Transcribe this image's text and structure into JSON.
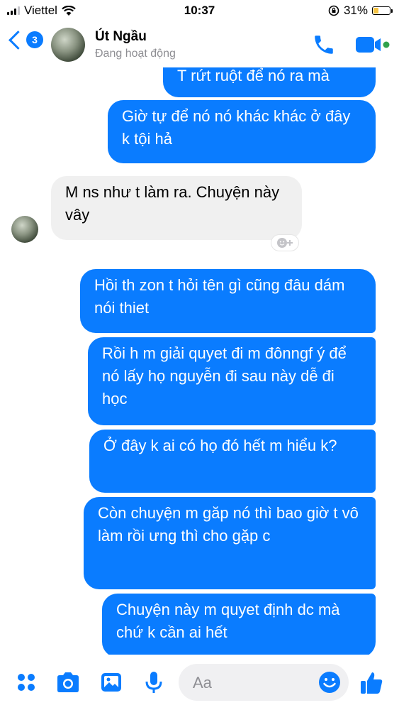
{
  "status_bar": {
    "carrier": "Viettel",
    "time": "10:37",
    "battery_percent": "31%",
    "battery_level": 0.31,
    "signal_bars": 3
  },
  "header": {
    "back_badge_count": "3",
    "contact_name": "Út Ngầu",
    "contact_status": "Đang hoạt động"
  },
  "messages": [
    {
      "direction": "outgoing",
      "text": "T rứt ruột để nó ra mà"
    },
    {
      "direction": "outgoing",
      "text": "Giờ tự để nó nó khác khác ở đây k tội hả"
    },
    {
      "direction": "incoming",
      "text": "M ns như t làm ra. Chuyện này vây"
    },
    {
      "direction": "outgoing",
      "text": "Hồi th zon t hỏi tên gì cũng đâu dám nói thiet"
    },
    {
      "direction": "outgoing",
      "text": "Rồi h m giải quyet đi m đônngf ý để nó lấy họ nguyễn đi sau này dễ đi học"
    },
    {
      "direction": "outgoing",
      "text": "Ở đây k ai có họ đó hết m hiểu k?"
    },
    {
      "direction": "outgoing",
      "text": "Còn chuyện m găp nó thì bao giờ t vô làm rồi ưng thì cho gặp c"
    },
    {
      "direction": "outgoing",
      "text": "Chuyện này m quyet định dc mà chứ k cần ai hết"
    }
  ],
  "composer": {
    "placeholder": "Aa"
  },
  "colors": {
    "accent": "#0a7cff",
    "incoming_bubble": "#f0f0f0",
    "active_dot": "#31a24c",
    "battery_fill": "#f6c343"
  },
  "icons": [
    "signal-icon",
    "wifi-icon",
    "orientation-lock-icon",
    "battery-icon",
    "back-chevron-icon",
    "phone-icon",
    "video-camera-icon",
    "menu-dots-icon",
    "camera-icon",
    "image-icon",
    "microphone-icon",
    "emoji-icon",
    "thumbs-up-icon",
    "add-reaction-icon"
  ]
}
